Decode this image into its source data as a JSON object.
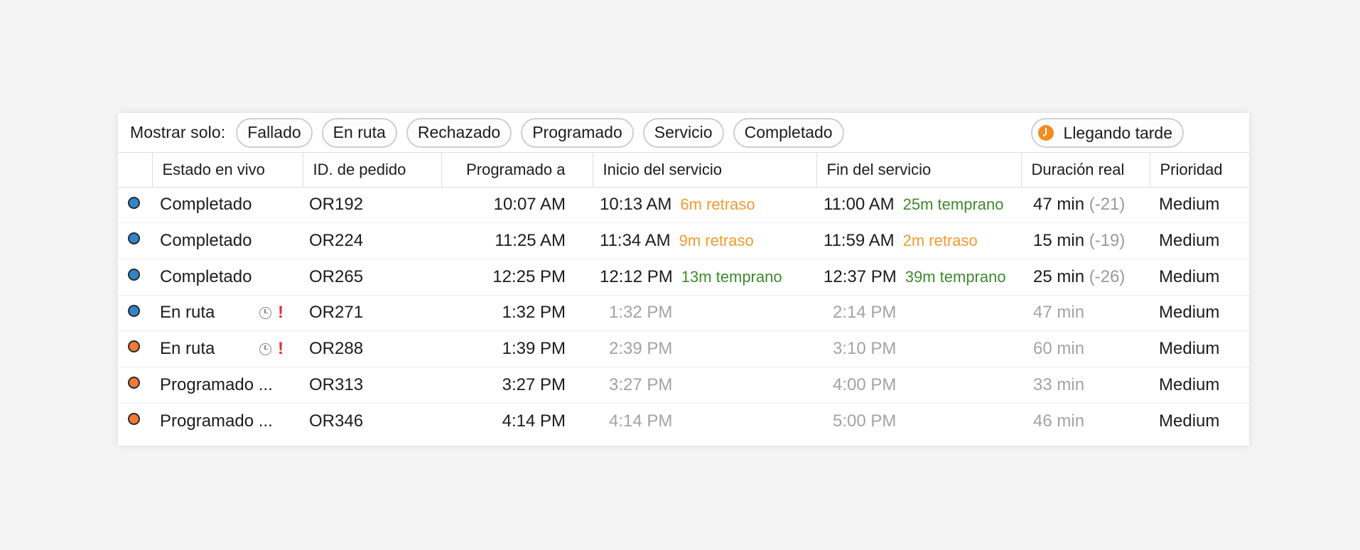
{
  "filters": {
    "label": "Mostrar solo:",
    "chips": [
      "Fallado",
      "En ruta",
      "Rechazado",
      "Programado",
      "Servicio",
      "Completado"
    ],
    "late_chip": "Llegando tarde"
  },
  "columns": {
    "estado": "Estado en vivo",
    "id": "ID. de pedido",
    "programado": "Programado a",
    "inicio": "Inicio del servicio",
    "fin": "Fin del servicio",
    "duracion": "Duración real",
    "prioridad": "Prioridad"
  },
  "colors": {
    "dot_blue": "#2f86c8",
    "dot_orange": "#f07a36",
    "late_orange": "#f29a2e",
    "early_green": "#3f8a2c",
    "alert_red": "#e02f2f"
  },
  "rows": [
    {
      "dot": "blue",
      "status": "Completado",
      "id": "OR192",
      "scheduled": "10:07 AM",
      "start": "10:13 AM",
      "start_note": "6m retraso",
      "start_note_type": "late",
      "end": "11:00 AM",
      "end_note": "25m temprano",
      "end_note_type": "early",
      "duration": "47 min",
      "duration_diff": "(-21)",
      "priority": "Medium"
    },
    {
      "dot": "blue",
      "status": "Completado",
      "id": "OR224",
      "scheduled": "11:25 AM",
      "start": "11:34 AM",
      "start_note": "9m retraso",
      "start_note_type": "late",
      "end": "11:59 AM",
      "end_note": "2m retraso",
      "end_note_type": "late",
      "duration": "15 min",
      "duration_diff": "(-19)",
      "priority": "Medium"
    },
    {
      "dot": "blue",
      "status": "Completado",
      "id": "OR265",
      "scheduled": "12:25 PM",
      "start": "12:12 PM",
      "start_note": "13m temprano",
      "start_note_type": "early",
      "end": "12:37 PM",
      "end_note": "39m temprano",
      "end_note_type": "early",
      "duration": "25 min",
      "duration_diff": "(-26)",
      "priority": "Medium"
    },
    {
      "dot": "blue",
      "status": "En ruta",
      "flags": true,
      "id": "OR271",
      "scheduled": "1:32 PM",
      "start": "1:32 PM",
      "end": "2:14 PM",
      "duration": "47 min",
      "priority": "Medium"
    },
    {
      "dot": "orange",
      "status": "En ruta",
      "flags": true,
      "id": "OR288",
      "scheduled": "1:39 PM",
      "start": "2:39 PM",
      "end": "3:10 PM",
      "duration": "60 min",
      "priority": "Medium"
    },
    {
      "dot": "orange",
      "status": "Programado ...",
      "id": "OR313",
      "scheduled": "3:27 PM",
      "start": "3:27 PM",
      "end": "4:00 PM",
      "duration": "33 min",
      "priority": "Medium"
    },
    {
      "dot": "orange",
      "status": "Programado ...",
      "id": "OR346",
      "scheduled": "4:14 PM",
      "start": "4:14 PM",
      "end": "5:00 PM",
      "duration": "46 min",
      "priority": "Medium"
    }
  ]
}
